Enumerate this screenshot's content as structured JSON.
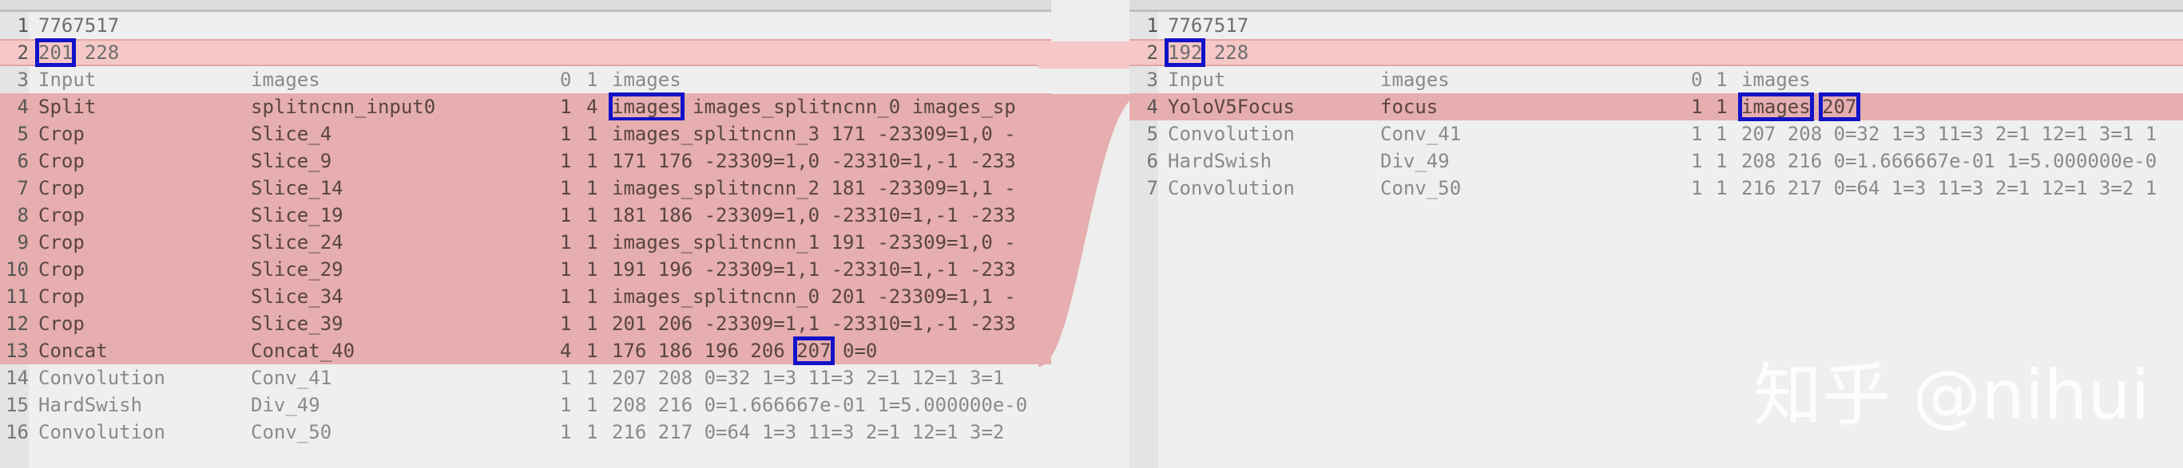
{
  "left": {
    "lines": [
      {
        "n": "1",
        "cells": [
          "7767517"
        ],
        "style": "plain"
      },
      {
        "n": "2",
        "cells": [
          "201",
          "228"
        ],
        "style": "pink-line",
        "hl": [
          0
        ]
      },
      {
        "n": "3",
        "cells": [
          "Input",
          "images",
          "0",
          "1",
          "images"
        ],
        "style": "plain-dim"
      },
      {
        "n": "4",
        "cells": [
          "Split",
          "splitncnn_input0",
          "1",
          "4",
          "images",
          "images_splitncnn_0 images_sp"
        ],
        "style": "pink",
        "hl": [
          4
        ]
      },
      {
        "n": "5",
        "cells": [
          "Crop",
          "Slice_4",
          "1",
          "1",
          "images_splitncnn_3 171 -23309=1,0 -"
        ],
        "style": "pink"
      },
      {
        "n": "6",
        "cells": [
          "Crop",
          "Slice_9",
          "1",
          "1",
          "171 176 -23309=1,0 -23310=1,-1 -233"
        ],
        "style": "pink"
      },
      {
        "n": "7",
        "cells": [
          "Crop",
          "Slice_14",
          "1",
          "1",
          "images_splitncnn_2 181 -23309=1,1 -"
        ],
        "style": "pink"
      },
      {
        "n": "8",
        "cells": [
          "Crop",
          "Slice_19",
          "1",
          "1",
          "181 186 -23309=1,0 -23310=1,-1 -233"
        ],
        "style": "pink"
      },
      {
        "n": "9",
        "cells": [
          "Crop",
          "Slice_24",
          "1",
          "1",
          "images_splitncnn_1 191 -23309=1,0 -"
        ],
        "style": "pink"
      },
      {
        "n": "10",
        "cells": [
          "Crop",
          "Slice_29",
          "1",
          "1",
          "191 196 -23309=1,1 -23310=1,-1 -233"
        ],
        "style": "pink"
      },
      {
        "n": "11",
        "cells": [
          "Crop",
          "Slice_34",
          "1",
          "1",
          "images_splitncnn_0 201 -23309=1,1 -"
        ],
        "style": "pink"
      },
      {
        "n": "12",
        "cells": [
          "Crop",
          "Slice_39",
          "1",
          "1",
          "201 206 -23309=1,1 -23310=1,-1 -233"
        ],
        "style": "pink"
      },
      {
        "n": "13",
        "cells": [
          "Concat",
          "Concat_40",
          "4",
          "1",
          "176 186 196 206",
          "207",
          "0=0"
        ],
        "style": "pink",
        "hl": [
          5
        ]
      },
      {
        "n": "14",
        "cells": [
          "Convolution",
          "Conv_41",
          "1",
          "1",
          "207 208 0=32 1=3 11=3 2=1 12=1 3=1"
        ],
        "style": "plain-dim"
      },
      {
        "n": "15",
        "cells": [
          "HardSwish",
          "Div_49",
          "1",
          "1",
          "208 216 0=1.666667e-01 1=5.000000e-0"
        ],
        "style": "plain-dim"
      },
      {
        "n": "16",
        "cells": [
          "Convolution",
          "Conv_50",
          "1",
          "1",
          "216 217 0=64 1=3 11=3 2=1 12=1 3=2"
        ],
        "style": "plain-dim"
      }
    ]
  },
  "right": {
    "lines": [
      {
        "n": "1",
        "cells": [
          "7767517"
        ],
        "style": "plain"
      },
      {
        "n": "2",
        "cells": [
          "192",
          "228"
        ],
        "style": "pink-line",
        "hl": [
          0
        ]
      },
      {
        "n": "3",
        "cells": [
          "Input",
          "images",
          "0",
          "1",
          "images"
        ],
        "style": "plain-dim"
      },
      {
        "n": "4",
        "cells": [
          "YoloV5Focus",
          "focus",
          "1",
          "1",
          "images",
          "207"
        ],
        "style": "pink",
        "hl": [
          4,
          5
        ]
      },
      {
        "n": "5",
        "cells": [
          "Convolution",
          "Conv_41",
          "1",
          "1",
          "207 208 0=32 1=3 11=3 2=1 12=1 3=1 1"
        ],
        "style": "plain-dim"
      },
      {
        "n": "6",
        "cells": [
          "HardSwish",
          "Div_49",
          "1",
          "1",
          "208 216 0=1.666667e-01 1=5.000000e-0"
        ],
        "style": "plain-dim"
      },
      {
        "n": "7",
        "cells": [
          "Convolution",
          "Conv_50",
          "1",
          "1",
          "216 217 0=64 1=3 11=3 2=1 12=1 3=2 1"
        ],
        "style": "plain-dim"
      }
    ]
  },
  "watermark": "知乎 @nihui",
  "colors": {
    "pink": "#e6aeae",
    "pink_line": "#f5c7c7",
    "highlight": "#1212c8",
    "background": "#efefef"
  }
}
